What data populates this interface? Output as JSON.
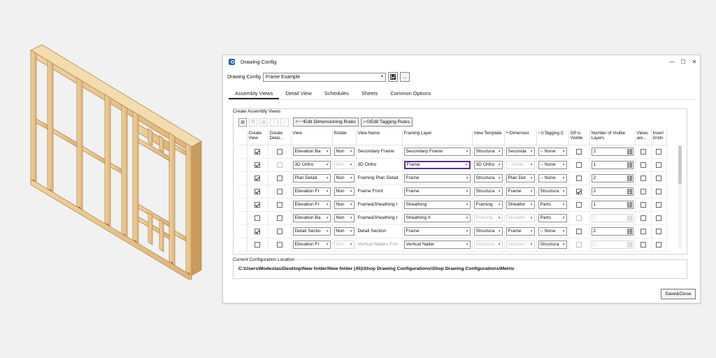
{
  "window": {
    "title": "Drawing Config",
    "controls": [
      "—",
      "☐",
      "✕"
    ]
  },
  "config": {
    "label": "Drawing Config",
    "value": "Frame Example",
    "browse_label": "..."
  },
  "tabs": [
    {
      "label": "Assembly Views",
      "active": true
    },
    {
      "label": "Detail View",
      "active": false
    },
    {
      "label": "Schedules",
      "active": false
    },
    {
      "label": "Sheets",
      "active": false
    },
    {
      "label": "Common Options",
      "active": false
    }
  ],
  "assembly_views": {
    "group_label": "Create Assembly Views",
    "edit_dimensioning_label": "Edit Dimensioning Rules",
    "edit_tagging_label": "Edit Tagging Rules",
    "columns": [
      "",
      "Create View",
      "Create Detai...",
      "View",
      "Rotate",
      "View Name",
      "Framing Layer",
      "View Template",
      "Dimensior",
      "Tagging C",
      "GP is Visible",
      "Number of Visible Layers",
      "Views are...",
      "Insert Grids"
    ],
    "rows": [
      {
        "create": true,
        "detail": false,
        "detail_enabled": true,
        "view": "Elevation Ba",
        "rotate": "Non",
        "rotate_enabled": true,
        "name": "Secondary Frame",
        "name_enabled": true,
        "layer": "Secondary Frame",
        "layer_enabled": true,
        "template": "Structura",
        "template_enabled": true,
        "dim": "Seconda",
        "dim_enabled": true,
        "tag": "-- None",
        "tag_enabled": true,
        "gp": false,
        "gp_enabled": true,
        "layers": "2",
        "layers_enabled": true,
        "views_are": false,
        "grids": false
      },
      {
        "create": true,
        "detail": false,
        "detail_enabled": false,
        "view": "3D Ortho",
        "rotate": "Non",
        "rotate_enabled": false,
        "name": "3D Ortho",
        "name_enabled": true,
        "layer": "Frame",
        "layer_enabled": true,
        "template": "3D Ortho",
        "template_enabled": true,
        "dim": "-- None",
        "dim_enabled": false,
        "tag": "-- None",
        "tag_enabled": true,
        "gp": false,
        "gp_enabled": true,
        "layers": "1",
        "layers_enabled": true,
        "views_are": false,
        "grids": false
      },
      {
        "create": true,
        "detail": false,
        "detail_enabled": true,
        "view": "Plan Detail",
        "rotate": "Non",
        "rotate_enabled": true,
        "name": "Framing Plan Detail",
        "name_enabled": true,
        "layer": "Frame",
        "layer_enabled": true,
        "template": "Structura",
        "template_enabled": true,
        "dim": "Plan Det",
        "dim_enabled": true,
        "tag": "-- None",
        "tag_enabled": true,
        "gp": false,
        "gp_enabled": true,
        "layers": "2",
        "layers_enabled": true,
        "views_are": false,
        "grids": false
      },
      {
        "create": true,
        "detail": false,
        "detail_enabled": true,
        "view": "Elevation Fr",
        "rotate": "Non",
        "rotate_enabled": true,
        "name": "Frame Front",
        "name_enabled": true,
        "layer": "Frame",
        "layer_enabled": true,
        "template": "Structura",
        "template_enabled": true,
        "dim": "Frame",
        "dim_enabled": true,
        "tag": "Structura",
        "tag_enabled": true,
        "gp": true,
        "gp_enabled": true,
        "layers": "2",
        "layers_enabled": true,
        "views_are": false,
        "grids": false
      },
      {
        "create": true,
        "detail": false,
        "detail_enabled": true,
        "view": "Elevation Fr",
        "rotate": "Non",
        "rotate_enabled": true,
        "name": "Frame&Sheathing I",
        "name_enabled": true,
        "layer": "Sheathing",
        "layer_enabled": true,
        "template": "Framing",
        "template_enabled": true,
        "dim": "Sheathir",
        "dim_enabled": true,
        "tag": "Parts",
        "tag_enabled": true,
        "gp": false,
        "gp_enabled": true,
        "layers": "1",
        "layers_enabled": true,
        "views_are": false,
        "grids": false
      },
      {
        "create": false,
        "detail": false,
        "detail_enabled": true,
        "view": "Elevation Ba",
        "rotate": "Non",
        "rotate_enabled": true,
        "name": "Frame&Sheathing I",
        "name_enabled": true,
        "layer": "Sheathing II",
        "layer_enabled": true,
        "template": "Framing",
        "template_enabled": false,
        "dim": "Sheathir",
        "dim_enabled": false,
        "tag": "Parts",
        "tag_enabled": true,
        "gp": false,
        "gp_enabled": false,
        "layers": "2",
        "layers_enabled": false,
        "views_are": false,
        "grids": false
      },
      {
        "create": true,
        "detail": false,
        "detail_enabled": true,
        "view": "Detail Sectio",
        "rotate": "Non",
        "rotate_enabled": true,
        "name": "Detail Section",
        "name_enabled": true,
        "layer": "Frame",
        "layer_enabled": true,
        "template": "Structura",
        "template_enabled": true,
        "dim": "Frame",
        "dim_enabled": true,
        "tag": "-- None",
        "tag_enabled": true,
        "gp": false,
        "gp_enabled": true,
        "layers": "2",
        "layers_enabled": true,
        "views_are": false,
        "grids": false
      },
      {
        "create": false,
        "detail": false,
        "detail_enabled": true,
        "view": "Elevation Fr",
        "rotate": "Non",
        "rotate_enabled": false,
        "name": "Vertical Nailers Fror",
        "name_enabled": false,
        "layer": "Vertical Nailer",
        "layer_enabled": true,
        "template": "Structura",
        "template_enabled": false,
        "dim": "Vertical I",
        "dim_enabled": false,
        "tag": "Structura",
        "tag_enabled": true,
        "gp": false,
        "gp_enabled": false,
        "layers": "2",
        "layers_enabled": false,
        "views_are": false,
        "grids": false
      }
    ]
  },
  "location": {
    "group_label": "Current Configuration Location",
    "path": "C:\\Users\\Modestas\\Desktop\\New folder\\New folder (45)\\Shop Drawing Configurations\\Shop Drawing Configurations\\Metric"
  },
  "footer": {
    "save_close_label": "Save&Close"
  },
  "colors": {
    "wood": "#e2bf86",
    "wood_dark": "#b98a52",
    "accent_focus": "#5b2d8e"
  }
}
